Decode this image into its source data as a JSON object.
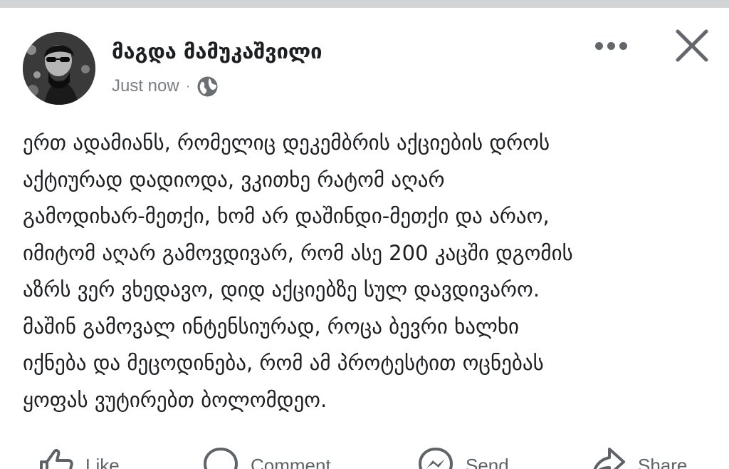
{
  "post": {
    "author": "მაგდა მამუკაშვილი",
    "timestamp": "Just now",
    "separator": "·",
    "privacy_icon": "globe-icon",
    "text": "ერთ ადამიანს, რომელიც დეკემბრის აქციების დროს\nაქტიურად დადიოდა, ვკითხე რატომ აღარ\nგამოდიხარ-მეთქი, ხომ არ დაშინდი-მეთქი და არაო,\nიმიტომ აღარ გამოვდივარ, რომ ასე 200 კაცში დგომის\nაზრს ვერ ვხედავო, დიდ აქციებზე სულ დავდივარო.\nმაშინ გამოვალ ინტენსიურად, როცა ბევრი ხალხი\nიქნება და მეცოდინება, რომ ამ პროტესტით ოცნებას\nყოფას ვუტირებთ ბოლომდეო."
  },
  "header_icons": {
    "more": "more-horizontal-icon",
    "close": "close-icon"
  },
  "actions": [
    {
      "label": "Like",
      "icon": "thumbs-up-icon"
    },
    {
      "label": "Comment",
      "icon": "comment-icon"
    },
    {
      "label": "Send",
      "icon": "messenger-icon"
    },
    {
      "label": "Share",
      "icon": "share-icon"
    }
  ]
}
